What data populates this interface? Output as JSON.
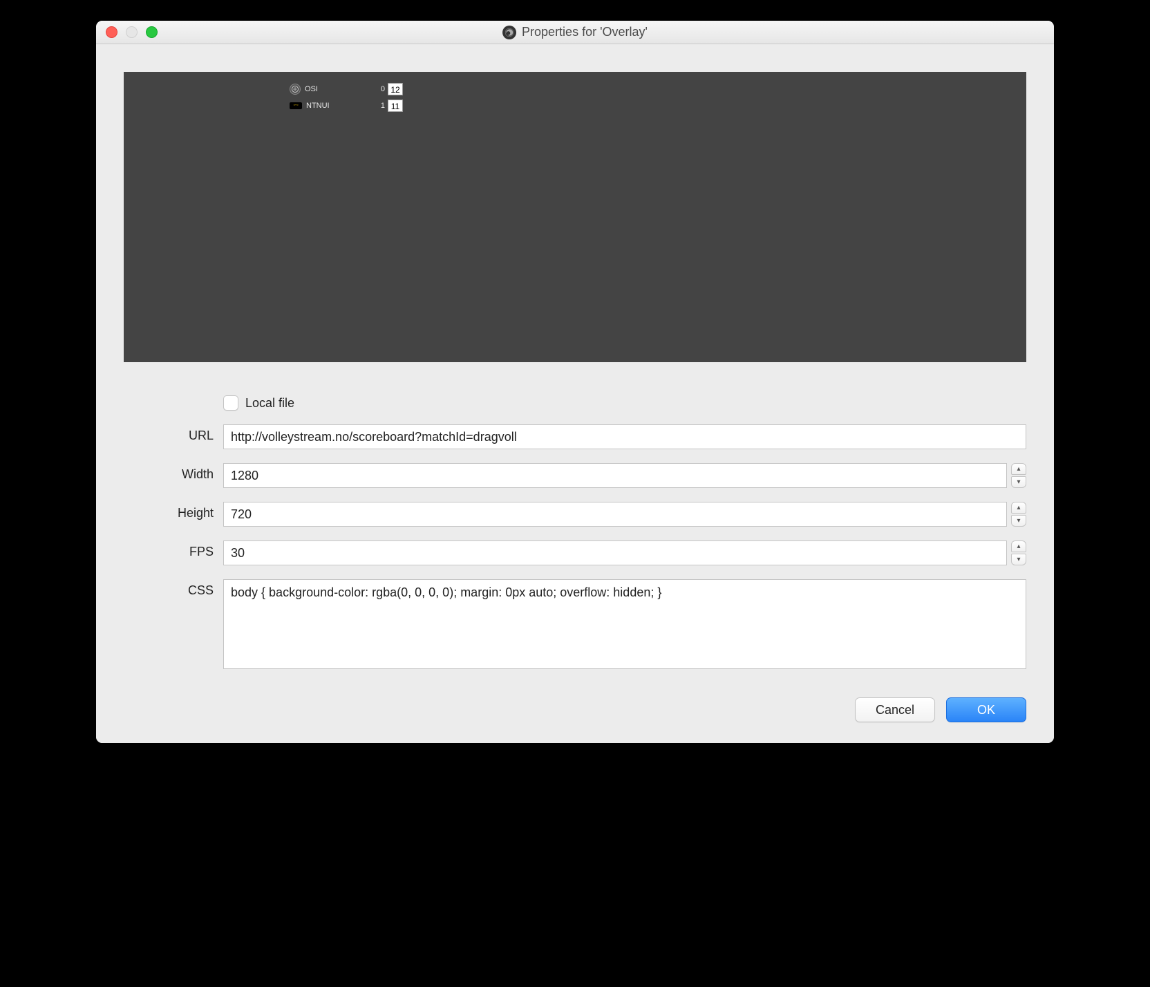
{
  "titlebar": {
    "title": "Properties for 'Overlay'"
  },
  "preview": {
    "scoreboard": {
      "team1": {
        "name": "OSI",
        "sets": "0",
        "points": "12"
      },
      "team2": {
        "name": "NTNUI",
        "sets": "1",
        "points": "11"
      }
    }
  },
  "form": {
    "local_file": {
      "label": "Local file",
      "checked": false
    },
    "url": {
      "label": "URL",
      "value": "http://volleystream.no/scoreboard?matchId=dragvoll"
    },
    "width": {
      "label": "Width",
      "value": "1280"
    },
    "height": {
      "label": "Height",
      "value": "720"
    },
    "fps": {
      "label": "FPS",
      "value": "30"
    },
    "css": {
      "label": "CSS",
      "value": "body { background-color: rgba(0, 0, 0, 0); margin: 0px auto; overflow: hidden; }"
    }
  },
  "footer": {
    "cancel": "Cancel",
    "ok": "OK"
  }
}
